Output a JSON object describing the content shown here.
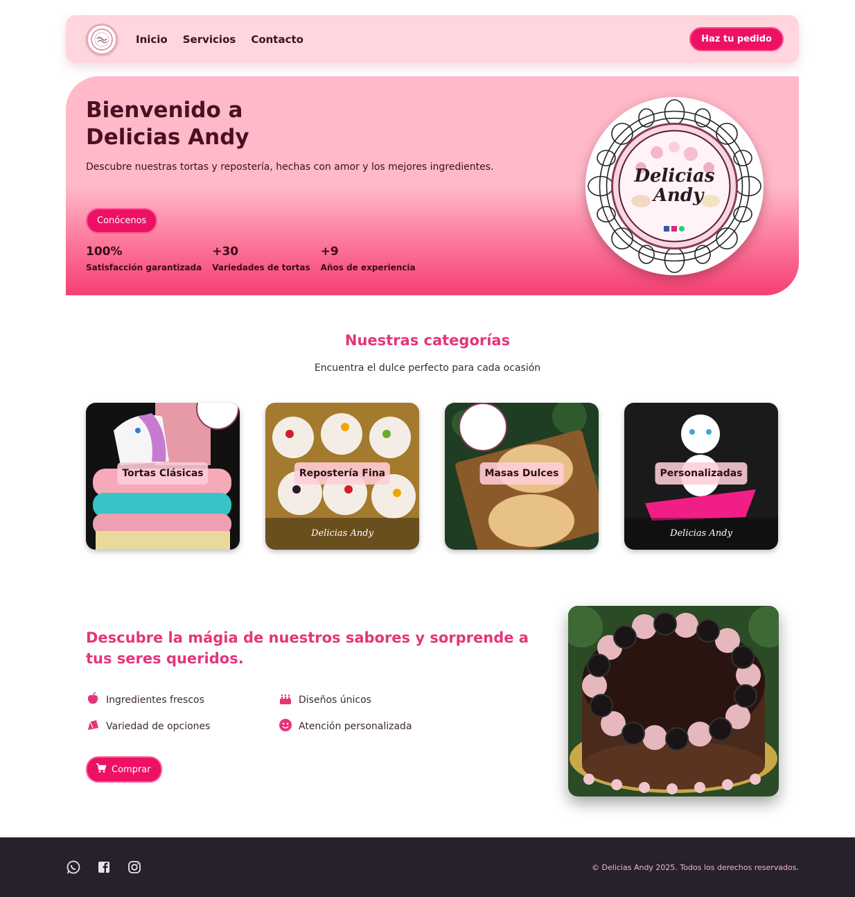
{
  "nav": {
    "links": [
      "Inicio",
      "Servicios",
      "Contacto"
    ],
    "cta": "Haz tu pedido"
  },
  "hero": {
    "title": "Bienvenido a\nDelicias Andy",
    "subtitle": "Descubre nuestras tortas y repostería, hechas con amor y los mejores ingredientes.",
    "button": "Conócenos",
    "stats": [
      {
        "value": "100%",
        "label": "Satisfacción garantizada"
      },
      {
        "value": "+30",
        "label": "Variedades de tortas"
      },
      {
        "value": "+9",
        "label": "Años de experiencia"
      }
    ],
    "badge_text": {
      "line1": "Delicias",
      "line2": "Andy"
    }
  },
  "categories": {
    "title": "Nuestras categorías",
    "subtitle": "Encuentra el dulce perfecto para cada ocasión",
    "items": [
      "Tortas Clásicas",
      "Repostería Fina",
      "Masas Dulces",
      "Personalizadas"
    ],
    "watermark": "Delicias Andy"
  },
  "promo": {
    "title": "Descubre la mágia de nuestros sabores y sorprende a tus seres queridos.",
    "features": [
      {
        "icon": "apple-icon",
        "label": "Ingredientes frescos"
      },
      {
        "icon": "cake-icon",
        "label": "Diseños únicos"
      },
      {
        "icon": "candy-icon",
        "label": "Variedad de opciones"
      },
      {
        "icon": "smile-icon",
        "label": "Atención personalizada"
      }
    ],
    "button": "Comprar"
  },
  "footer": {
    "social": [
      "whatsapp-icon",
      "facebook-icon",
      "instagram-icon"
    ],
    "copyright": "© Delicias Andy 2025. Todos los derechos reservados."
  },
  "colors": {
    "accent": "#ec1164",
    "heading": "#e5357a",
    "nav_bg": "#ffd6de",
    "footer_bg": "#27212b"
  }
}
